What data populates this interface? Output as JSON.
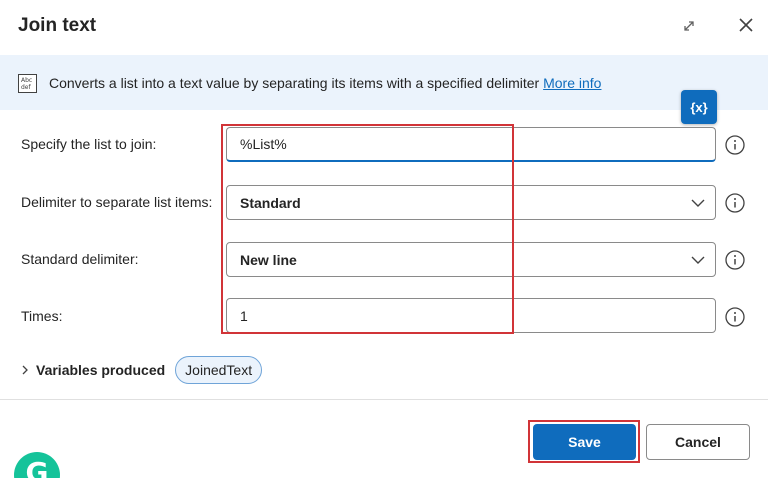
{
  "dialog": {
    "title": "Join text"
  },
  "info": {
    "text": "Converts a list into a text value by separating its items with a specified delimiter",
    "link": "More info"
  },
  "variables_button": "{x}",
  "fields": {
    "list": {
      "label": "Specify the list to join:",
      "value": "%List%"
    },
    "delimiter": {
      "label": "Delimiter to separate list items:",
      "value": "Standard"
    },
    "standard": {
      "label": "Standard delimiter:",
      "value": "New line"
    },
    "times": {
      "label": "Times:",
      "value": "1"
    }
  },
  "variables_produced": {
    "label": "Variables produced",
    "items": [
      "JoinedText"
    ]
  },
  "footer": {
    "save": "Save",
    "cancel": "Cancel"
  },
  "colors": {
    "accent": "#0f6cbd",
    "highlight": "#d13438",
    "info_bg": "#ebf3fc",
    "grammarly": "#15c39a"
  },
  "icons": [
    "expand-icon",
    "close-icon",
    "text-info-icon",
    "help-circle-icon",
    "chevron-down-icon",
    "chevron-right-icon",
    "grammarly-icon"
  ]
}
